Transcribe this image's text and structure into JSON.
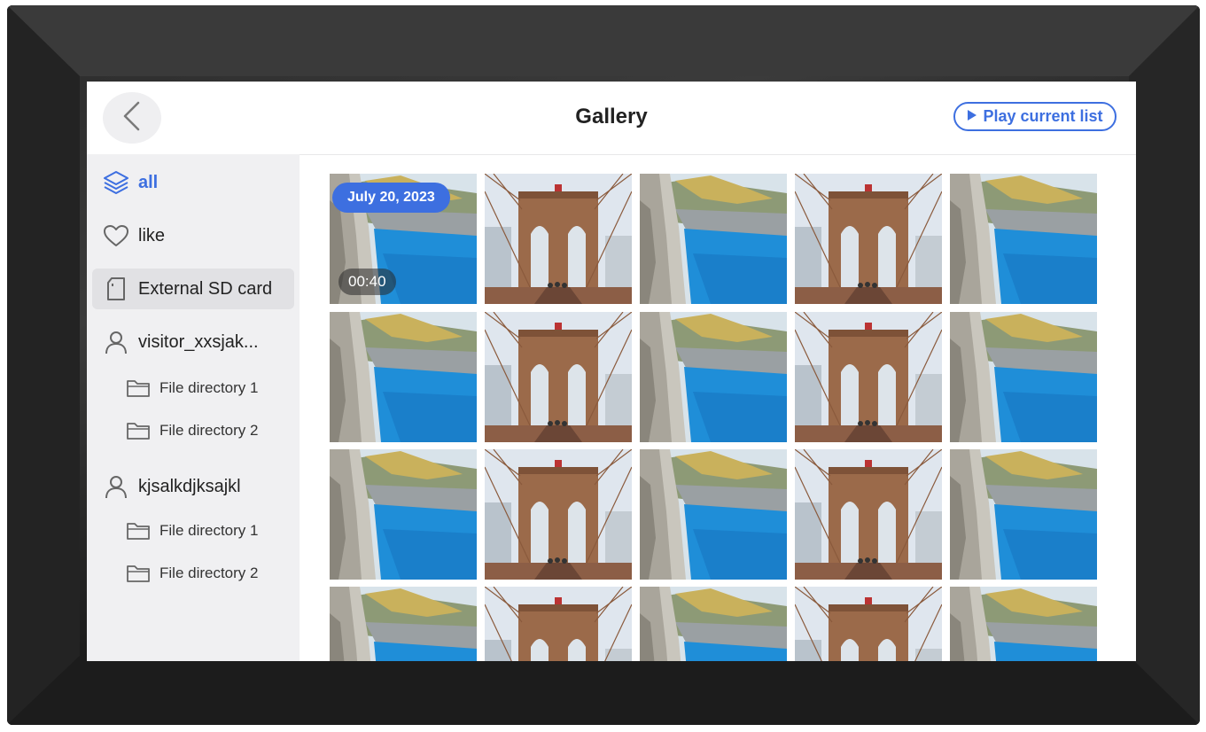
{
  "header": {
    "title": "Gallery",
    "back_icon": "chevron-left-icon",
    "play_button": {
      "label": "Play current list",
      "icon": "play-icon"
    }
  },
  "sidebar": {
    "items": [
      {
        "label": "all",
        "icon": "layers-icon",
        "active": true
      },
      {
        "label": "like",
        "icon": "heart-icon"
      },
      {
        "label": "External SD card",
        "icon": "sd-card-icon",
        "highlighted": true
      },
      {
        "label": "visitor_xxsjak...",
        "icon": "user-icon",
        "children": [
          {
            "label": "File directory 1",
            "icon": "folder-icon"
          },
          {
            "label": "File directory 2",
            "icon": "folder-icon"
          }
        ]
      },
      {
        "label": "kjsalkdjksajkl",
        "icon": "user-icon",
        "children": [
          {
            "label": "File directory 1",
            "icon": "folder-icon"
          },
          {
            "label": "File directory 2",
            "icon": "folder-icon"
          }
        ]
      }
    ]
  },
  "gallery": {
    "first_item": {
      "date": "July 20, 2023",
      "duration": "00:40"
    },
    "columns": 5,
    "column_subjects": [
      "coastal-cliff",
      "bridge",
      "coastal-cliff",
      "bridge",
      "coastal-cliff"
    ],
    "visible_rows": 4
  },
  "colors": {
    "accent": "#3d6fe0",
    "bezel": "#2a2a2a",
    "sidebar_bg": "#f0f0f2"
  }
}
